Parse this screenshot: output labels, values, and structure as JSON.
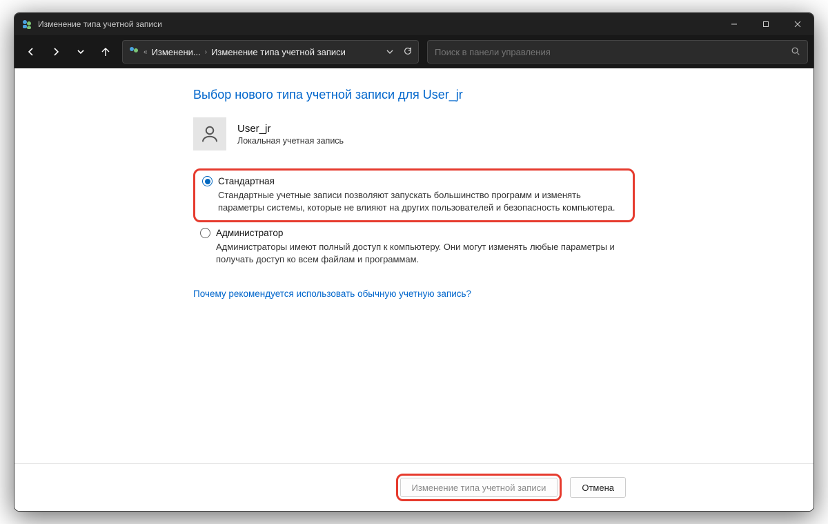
{
  "window": {
    "title": "Изменение типа учетной записи"
  },
  "breadcrumb": {
    "segment1": "Изменени...",
    "segment2": "Изменение типа учетной записи"
  },
  "search": {
    "placeholder": "Поиск в панели управления"
  },
  "page": {
    "heading": "Выбор нового типа учетной записи для User_jr"
  },
  "user": {
    "name": "User_jr",
    "account_kind": "Локальная учетная запись"
  },
  "options": {
    "standard": {
      "label": "Стандартная",
      "desc": "Стандартные учетные записи позволяют запускать большинство программ и изменять параметры системы, которые не влияют на других пользователей и безопасность компьютера.",
      "selected": true
    },
    "admin": {
      "label": "Администратор",
      "desc": "Администраторы имеют полный доступ к компьютеру. Они могут изменять любые параметры и получать доступ ко всем файлам и программам.",
      "selected": false
    }
  },
  "help_link": "Почему рекомендуется использовать обычную учетную запись?",
  "buttons": {
    "change": "Изменение типа учетной записи",
    "cancel": "Отмена"
  },
  "highlight_color": "#e63b2e",
  "accent_color": "#0067c0"
}
